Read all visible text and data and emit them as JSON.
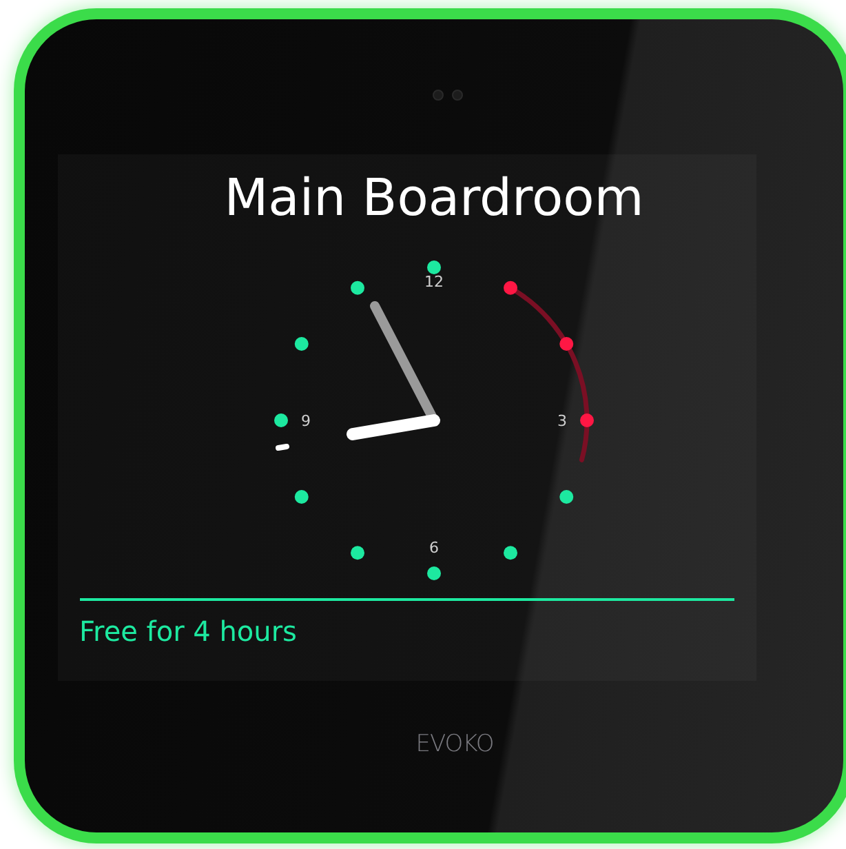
{
  "device": {
    "brand": "EVOKO"
  },
  "screen": {
    "room_name": "Main Boardroom",
    "clock": {
      "numerals": [
        {
          "hour": "12"
        },
        {
          "hour": "3"
        },
        {
          "hour": "6"
        },
        {
          "hour": "9"
        }
      ],
      "slots": [
        {
          "booked": false
        },
        {
          "booked": true
        },
        {
          "booked": true
        },
        {
          "booked": true
        },
        {
          "booked": false
        },
        {
          "booked": false
        },
        {
          "booked": false
        },
        {
          "booked": false
        },
        {
          "booked": false
        },
        {
          "booked": false
        },
        {
          "booked": false
        },
        {
          "booked": false
        }
      ]
    },
    "status": "Free for 4 hours"
  }
}
